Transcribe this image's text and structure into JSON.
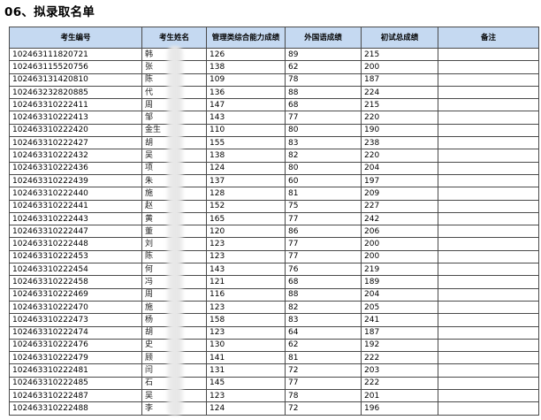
{
  "title": "06、拟录取名单",
  "table": {
    "headers": [
      "考生编号",
      "考生姓名",
      "管理类综合能力成绩",
      "外国语成绩",
      "初试总成绩",
      "备注"
    ],
    "rows": [
      [
        "102463111820721",
        "韩",
        "126",
        "89",
        "215",
        ""
      ],
      [
        "102463115520756",
        "张",
        "138",
        "62",
        "200",
        ""
      ],
      [
        "102463131420810",
        "陈",
        "109",
        "78",
        "187",
        ""
      ],
      [
        "102463232820885",
        "代",
        "136",
        "88",
        "224",
        ""
      ],
      [
        "102463310222411",
        "周",
        "147",
        "68",
        "215",
        ""
      ],
      [
        "102463310222413",
        "邹",
        "143",
        "77",
        "220",
        ""
      ],
      [
        "102463310222420",
        "金生",
        "110",
        "80",
        "190",
        ""
      ],
      [
        "102463310222427",
        "胡",
        "155",
        "83",
        "238",
        ""
      ],
      [
        "102463310222432",
        "吴",
        "138",
        "82",
        "220",
        ""
      ],
      [
        "102463310222436",
        "项",
        "124",
        "80",
        "204",
        ""
      ],
      [
        "102463310222439",
        "朱",
        "137",
        "60",
        "197",
        ""
      ],
      [
        "102463310222440",
        "施",
        "128",
        "81",
        "209",
        ""
      ],
      [
        "102463310222441",
        "赵",
        "152",
        "75",
        "227",
        ""
      ],
      [
        "102463310222443",
        "黄",
        "165",
        "77",
        "242",
        ""
      ],
      [
        "102463310222447",
        "董",
        "120",
        "86",
        "206",
        ""
      ],
      [
        "102463310222448",
        "刘",
        "123",
        "77",
        "200",
        ""
      ],
      [
        "102463310222453",
        "陈",
        "123",
        "77",
        "200",
        ""
      ],
      [
        "102463310222454",
        "何",
        "143",
        "76",
        "219",
        ""
      ],
      [
        "102463310222458",
        "冯",
        "121",
        "68",
        "189",
        ""
      ],
      [
        "102463310222469",
        "周",
        "116",
        "88",
        "204",
        ""
      ],
      [
        "102463310222470",
        "施",
        "123",
        "82",
        "205",
        ""
      ],
      [
        "102463310222473",
        "杨",
        "158",
        "83",
        "241",
        ""
      ],
      [
        "102463310222474",
        "胡",
        "123",
        "64",
        "187",
        ""
      ],
      [
        "102463310222476",
        "史",
        "130",
        "62",
        "192",
        ""
      ],
      [
        "102463310222479",
        "顾",
        "141",
        "81",
        "222",
        ""
      ],
      [
        "102463310222481",
        "闫",
        "131",
        "72",
        "203",
        ""
      ],
      [
        "102463310222485",
        "石",
        "145",
        "77",
        "222",
        ""
      ],
      [
        "102463310222487",
        "吴",
        "123",
        "78",
        "201",
        ""
      ],
      [
        "102463310222488",
        "李",
        "124",
        "72",
        "196",
        ""
      ]
    ]
  }
}
